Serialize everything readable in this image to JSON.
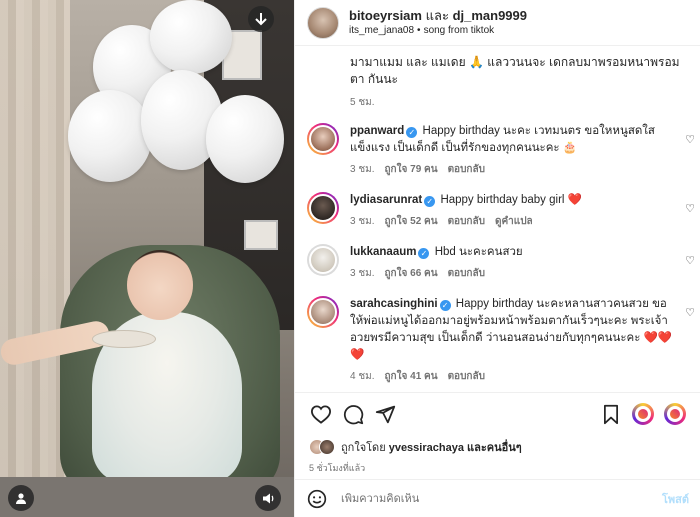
{
  "header": {
    "user1": "bitoeyrsiam",
    "conjunction": "และ",
    "user2": "dj_man9999",
    "tagged": "its_me_jana08",
    "audio": "song from tiktok"
  },
  "first_comment": {
    "text": "มามาแมม และ แมเดย 🙏 แลววนนจะ เดกลบมาพรอมหนาพรอมตา กันนะ",
    "time": "5 ชม."
  },
  "comments": [
    {
      "username": "ppanward",
      "text": "Happy birthday นะคะ เวทมนตร ขอใหหนูสดใสแข็งแรง เป็นเด็กดี เป็นที่รักของทุกคนนะคะ 🎂",
      "time": "3 ชม.",
      "likes": "ถูกใจ 79 คน",
      "reply": "ตอบกลับ",
      "translate": ""
    },
    {
      "username": "lydiasarunrat",
      "text": "Happy birthday baby girl ❤️",
      "time": "3 ชม.",
      "likes": "ถูกใจ 52 คน",
      "reply": "ตอบกลับ",
      "translate": "ดูคำแปล"
    },
    {
      "username": "lukkanaaum",
      "text": "Hbd นะคะคนสวย",
      "time": "3 ชม.",
      "likes": "ถูกใจ 66 คน",
      "reply": "ตอบกลับ",
      "translate": ""
    },
    {
      "username": "sarahcasinghini",
      "text": "Happy birthday นะคะหลานสาวคนสวย ขอให้พ่อแม่หนูได้ออกมาอยู่พร้อมหน้าพร้อมตากันเร็วๆนะคะ พระเจ้าอวยพรมีความสุข เป็นเด็กดี ว่านอนสอนง่ายกับทุกๆคนนะคะ ❤️❤️❤️",
      "time": "4 ชม.",
      "likes": "ถูกใจ 41 คน",
      "reply": "ตอบกลับ",
      "translate": ""
    }
  ],
  "likes_line": {
    "prefix": "ถูกใจโดย",
    "user": "yvessirachaya",
    "suffix": "และคนอื่นๆ"
  },
  "posted_time": "5 ชั่วโมงที่แล้ว",
  "add_comment": {
    "placeholder": "เพิ่มความคิดเห็น",
    "post_label": "โพสต์"
  },
  "colors": {
    "accent": "#0095f6",
    "verified": "#3897f0",
    "heart_red": "#ed4956"
  },
  "icons": {
    "download": "arrow-down-icon",
    "user_tag": "user-icon",
    "sound": "speaker-icon",
    "like": "heart-icon",
    "comment": "comment-bubble-icon",
    "share": "paper-plane-icon",
    "save": "bookmark-icon",
    "emoji": "smiley-icon"
  }
}
